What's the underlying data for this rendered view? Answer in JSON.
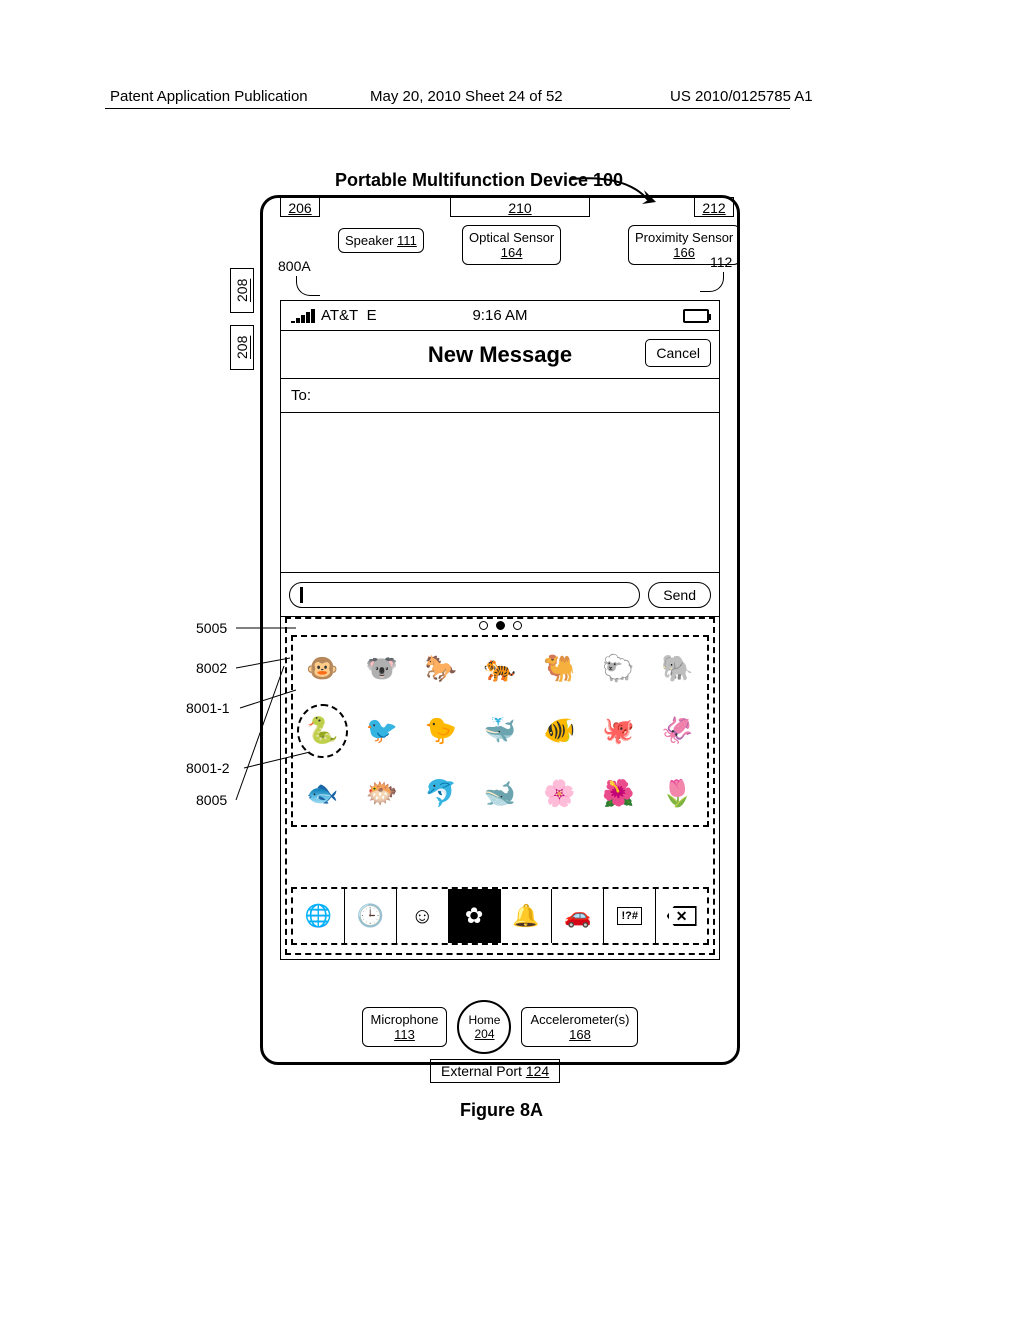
{
  "header": {
    "left": "Patent Application Publication",
    "mid": "May 20, 2010 Sheet 24 of 52",
    "right": "US 2010/0125785 A1"
  },
  "device": {
    "title": "Portable Multifunction Device 100",
    "ref206": "206",
    "ref210": "210",
    "ref212": "212",
    "ref208": "208",
    "speaker": "Speaker ",
    "speaker_num": "111",
    "optical": "Optical Sensor ",
    "optical_num": "164",
    "proximity": "Proximity Sensor ",
    "proximity_num": "166",
    "label800A": "800A",
    "label112": "112"
  },
  "status": {
    "carrier": "AT&T",
    "net": "E",
    "time": "9:16 AM"
  },
  "nav": {
    "title": "New Message",
    "cancel": "Cancel"
  },
  "compose": {
    "to_label": "To:",
    "send": "Send"
  },
  "emoji": {
    "row1": [
      "🐵",
      "🐨",
      "🐎",
      "🐅",
      "🐫",
      "🐑",
      "🐘"
    ],
    "row2": [
      "🐍",
      "🐦",
      "🐤",
      "🐳",
      "🐠",
      "🐙",
      "🦑"
    ],
    "row3": [
      "🐟",
      "🐡",
      "🐬",
      "🐋",
      "🌸",
      "🌺",
      "🌷"
    ]
  },
  "categories": {
    "globe": "🌐",
    "recent": "🕒",
    "smiley": "☺",
    "flower": "✿",
    "bell": "🔔",
    "car": "🚗",
    "symbols": "!?#",
    "delete": "✕"
  },
  "bottom": {
    "microphone": "Microphone",
    "microphone_num": "113",
    "home": "Home",
    "home_num": "204",
    "accel": "Accelerometer(s)",
    "accel_num": "168",
    "port": "External Port ",
    "port_num": "124"
  },
  "callouts": {
    "c5005": "5005",
    "c8002": "8002",
    "c80011": "8001-1",
    "c80012": "8001-2",
    "c8005": "8005"
  },
  "figure": "Figure 8A"
}
